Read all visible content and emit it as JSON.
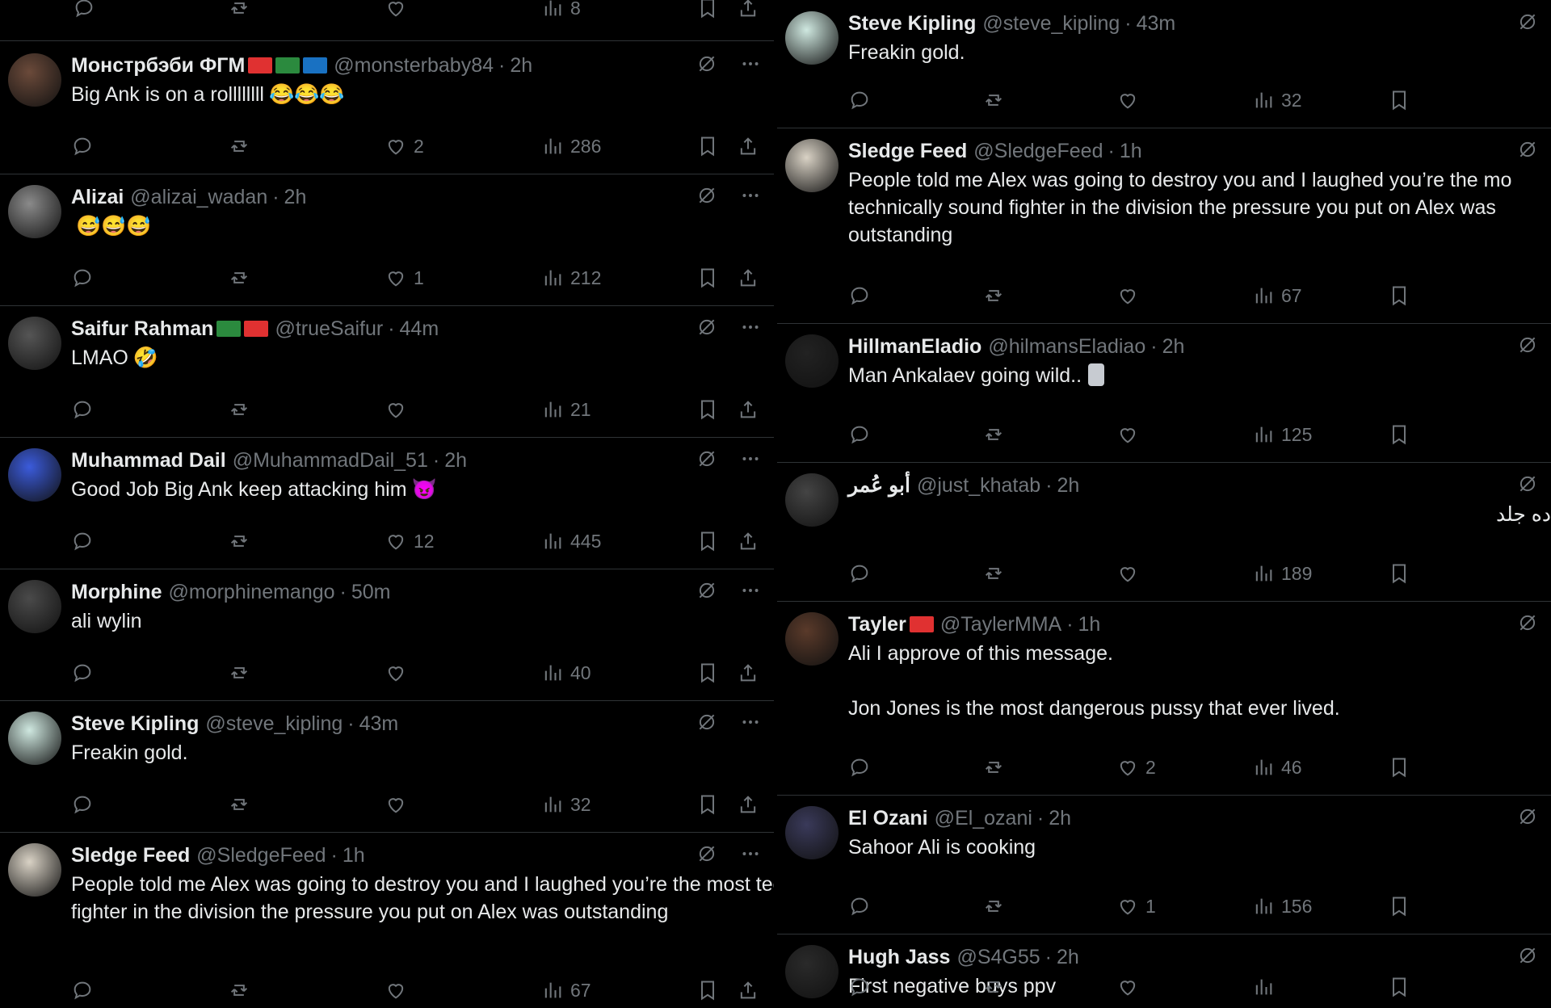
{
  "left_column": {
    "top_partial_views": "8",
    "tweets": [
      {
        "name": "Монстрбэби ФГМ",
        "handle": "@monsterbaby84",
        "time": "2h",
        "text": "Big Ank is on a rollllllll",
        "emoji": "😂😂😂",
        "likes": "2",
        "views": "286"
      },
      {
        "name": "Alizai",
        "handle": "@alizai_wadan",
        "time": "2h",
        "text": "",
        "emoji": "😅😅😅",
        "likes": "1",
        "views": "212"
      },
      {
        "name": "Saifur Rahman",
        "handle": "@trueSaifur",
        "time": "44m",
        "text": "LMAO",
        "emoji": "🤣",
        "likes": "",
        "views": "21"
      },
      {
        "name": "Muhammad Dail",
        "handle": "@MuhammadDail_51",
        "time": "2h",
        "text": "Good Job Big Ank keep attacking him",
        "emoji": "😈",
        "likes": "12",
        "views": "445"
      },
      {
        "name": "Morphine",
        "handle": "@morphinemango",
        "time": "50m",
        "text": "ali wylin",
        "emoji": "",
        "likes": "",
        "views": "40"
      },
      {
        "name": "Steve Kipling",
        "handle": "@steve_kipling",
        "time": "43m",
        "text": "Freakin gold.",
        "emoji": "",
        "likes": "",
        "views": "32"
      },
      {
        "name": "Sledge Feed",
        "handle": "@SledgeFeed",
        "time": "1h",
        "text": "People told me Alex was going to destroy you and I laughed you’re the most technically sound fighter in the division the pressure you put on Alex was outstanding",
        "emoji": "",
        "likes": "",
        "views": "67"
      }
    ]
  },
  "right_column": {
    "tweets": [
      {
        "name": "Steve Kipling",
        "handle": "@steve_kipling",
        "time": "43m",
        "text": "Freakin gold.",
        "likes": "",
        "views": "32"
      },
      {
        "name": "Sledge Feed",
        "handle": "@SledgeFeed",
        "time": "1h",
        "text": "People told me Alex was going to destroy you and I laughed you’re the mo\ntechnically sound fighter in the division the pressure you put on Alex was\noutstanding",
        "likes": "",
        "views": "67"
      },
      {
        "name": "HillmanEladio",
        "handle": "@hilmansEladiao",
        "time": "2h",
        "text": "Man Ankalaev going wild..",
        "likes": "",
        "views": "125"
      },
      {
        "name": "أبو عُمر",
        "handle": "@just_khatab",
        "time": "2h",
        "text": "ده جلد",
        "likes": "",
        "views": "189"
      },
      {
        "name": "Tayler",
        "handle": "@TaylerMMA",
        "time": "1h",
        "text": "Ali I approve of this message.\n\nJon Jones is the most dangerous pussy that ever lived.",
        "likes": "2",
        "views": "46"
      },
      {
        "name": "El Ozani",
        "handle": "@El_ozani",
        "time": "2h",
        "text": "Sahoor Ali is cooking",
        "likes": "1",
        "views": "156"
      },
      {
        "name": "Hugh Jass",
        "handle": "@S4G55",
        "time": "2h",
        "text": "First negative buys ppv",
        "likes": "",
        "views": ""
      }
    ]
  },
  "separator": "·",
  "colors": {
    "background": "#000000",
    "text": "#e7e9ea",
    "muted": "#71767b",
    "border": "#2f3336"
  }
}
